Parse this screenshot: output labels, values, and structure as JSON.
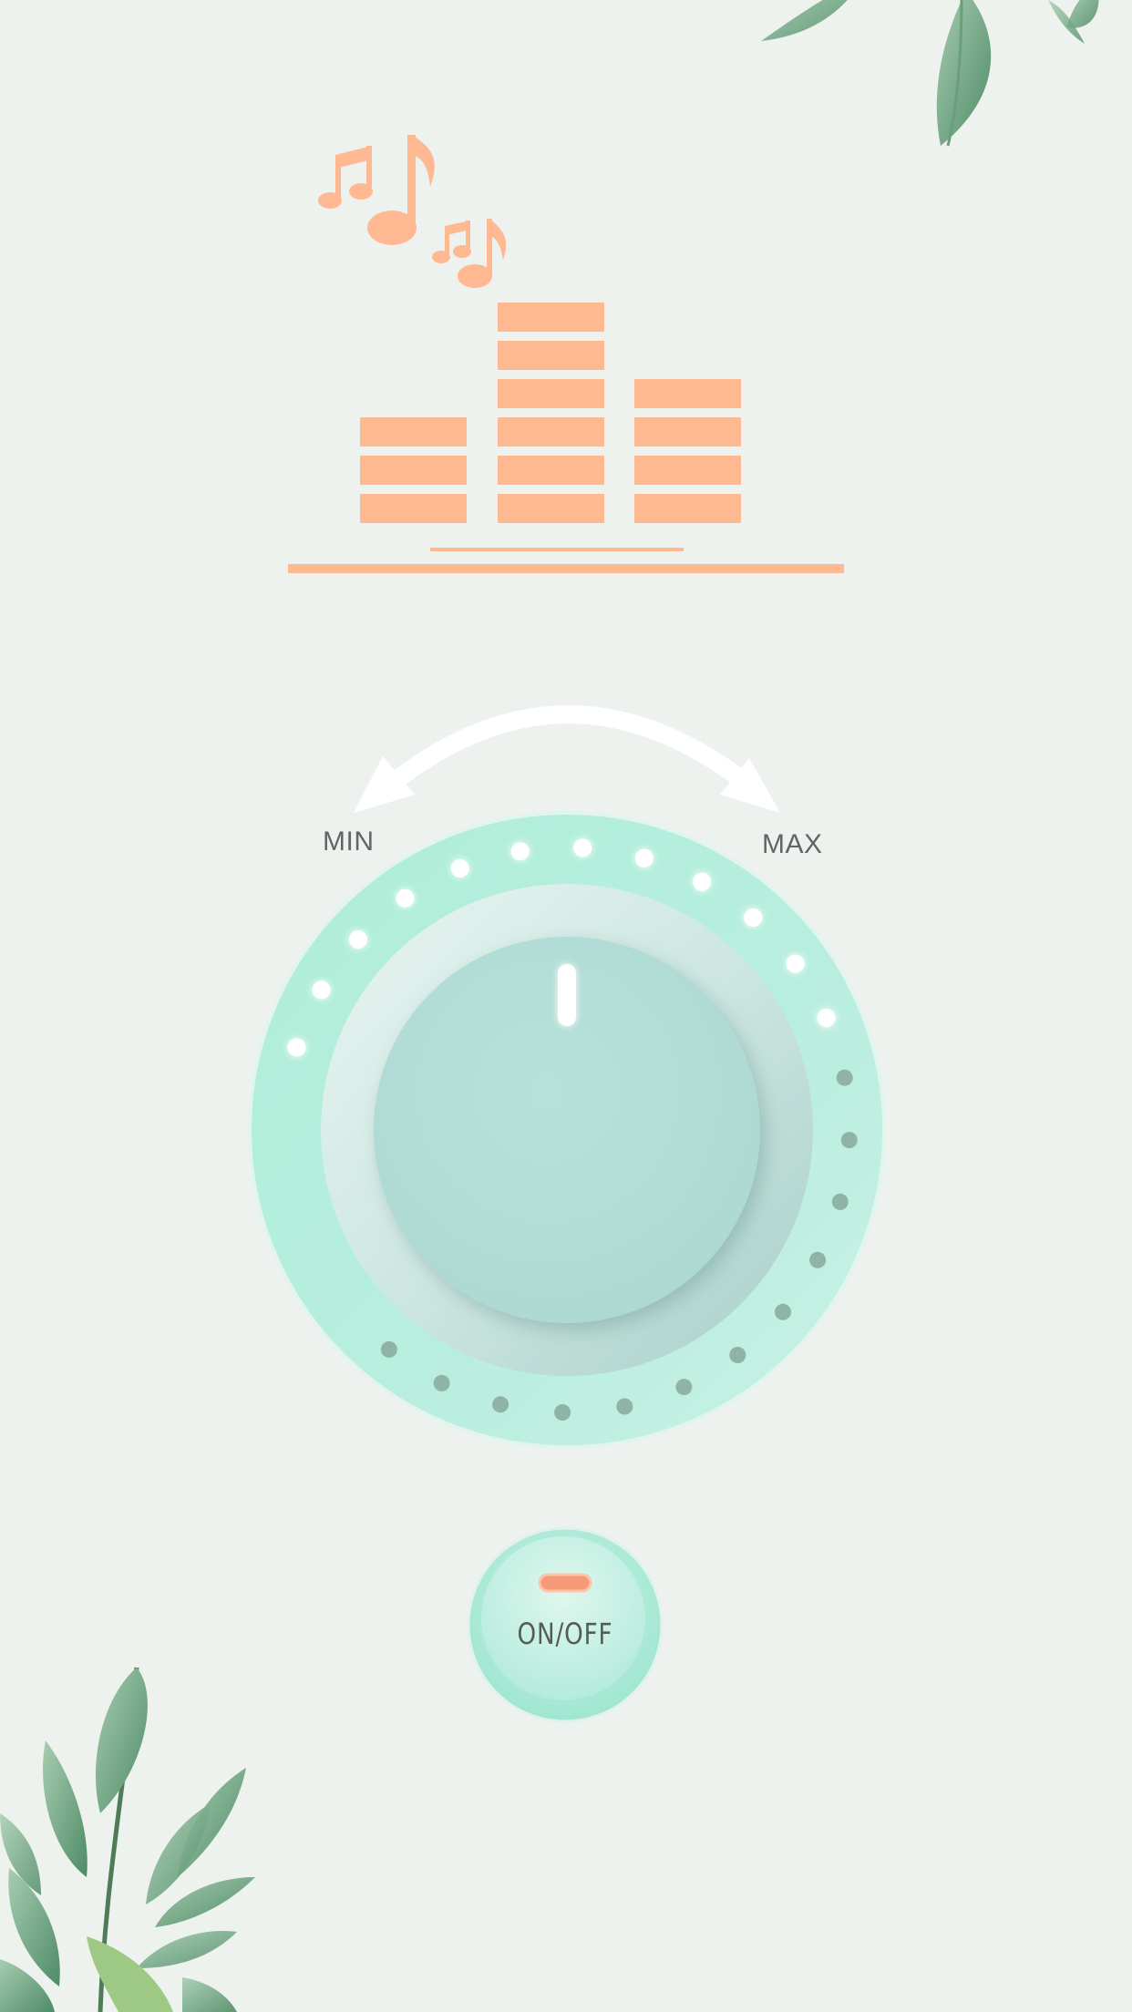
{
  "volume_control": {
    "min_label": "MIN",
    "max_label": "MAX",
    "level": 0.5,
    "lit_dots": 12,
    "total_dots": 24
  },
  "power_button": {
    "label": "ON/OFF"
  },
  "colors": {
    "background": "#eef2ee",
    "accent": "#ffb992",
    "knob_ring": "#b8efdc",
    "knob_face": "#b3dcd6",
    "dot_on": "#ffffff",
    "dot_off": "#8fb3a6"
  },
  "icons": [
    "music-notes-icon",
    "equalizer-bars-icon",
    "rotate-arrow-icon",
    "leaf-decoration-top-right",
    "leaf-decoration-bottom-left"
  ]
}
